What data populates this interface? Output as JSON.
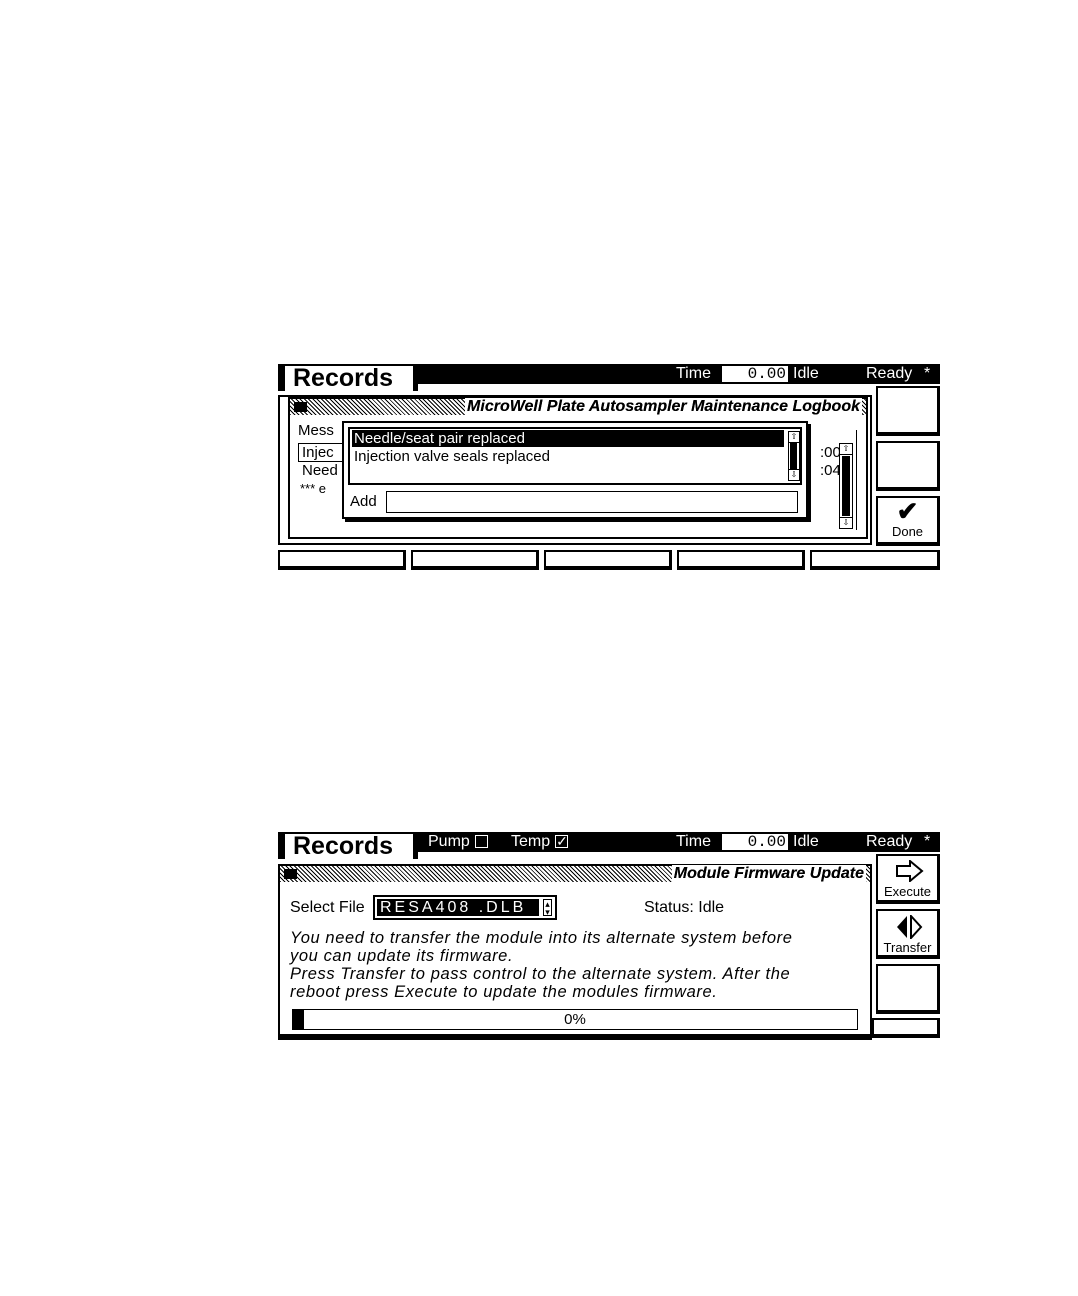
{
  "screen1": {
    "tab_title": "Records",
    "header": {
      "time_label": "Time",
      "time_value": "0.00",
      "state": "Idle",
      "ready": "Ready",
      "asterisk": "*"
    },
    "panel_title": "MicroWell Plate Autosampler Maintenance Logbook",
    "background_partial": {
      "label": "Mess",
      "rows": [
        "Injec",
        "Need",
        "*** e"
      ],
      "times": [
        ":00",
        ":04"
      ]
    },
    "popup": {
      "items": [
        "Needle/seat pair replaced",
        "Injection valve seals replaced"
      ],
      "selected_index": 0,
      "add_label": "Add",
      "add_value": ""
    },
    "side_buttons": [
      "",
      "",
      "Done"
    ],
    "done_icon": "check-icon"
  },
  "screen2": {
    "tab_title": "Records",
    "header": {
      "pump_label": "Pump",
      "pump_checked": false,
      "temp_label": "Temp",
      "temp_checked": true,
      "time_label": "Time",
      "time_value": "0.00",
      "state": "Idle",
      "ready": "Ready",
      "asterisk": "*"
    },
    "panel_title": "Module Firmware Update",
    "select_file_label": "Select File",
    "select_file_value": "RESA408 .DLB",
    "status": "Status: Idle",
    "message_lines": [
      "You need to transfer the module into its alternate system before",
      "you can update its firmware.",
      "Press Transfer to pass control to the alternate system. After the",
      "reboot press Execute to update the modules firmware."
    ],
    "progress_percent": 0,
    "progress_label": "0%",
    "side_buttons": {
      "execute": "Execute",
      "transfer": "Transfer",
      "empty": ""
    },
    "icons": {
      "execute": "arrow-right-icon",
      "transfer": "transfer-arrows-icon"
    }
  }
}
